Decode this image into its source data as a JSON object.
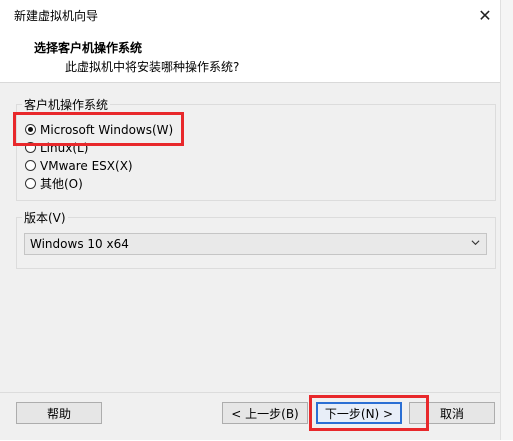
{
  "window": {
    "title": "新建虚拟机向导"
  },
  "header": {
    "title": "选择客户机操作系统",
    "subtitle": "此虚拟机中将安装哪种操作系统?"
  },
  "os_group": {
    "label": "客户机操作系统",
    "options": [
      {
        "label": "Microsoft Windows(W)",
        "checked": true
      },
      {
        "label": "Linux(L)",
        "checked": false
      },
      {
        "label": "VMware ESX(X)",
        "checked": false
      },
      {
        "label": "其他(O)",
        "checked": false
      }
    ]
  },
  "version": {
    "label": "版本(V)",
    "selected": "Windows 10 x64"
  },
  "buttons": {
    "help": "帮助",
    "back": "< 上一步(B)",
    "next": "下一步(N) >",
    "cancel": "取消"
  },
  "colors": {
    "highlight": "#e8282b",
    "default_button_border": "#2b6fd4"
  },
  "icons": {
    "close": "close-icon",
    "dropdown": "chevron-down-icon"
  }
}
